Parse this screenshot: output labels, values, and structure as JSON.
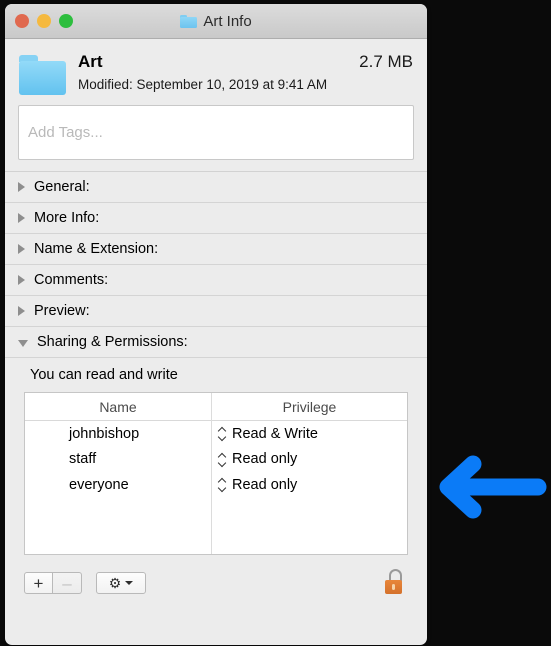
{
  "window": {
    "title": "Art Info",
    "title_icon": "folder-icon",
    "traffic_lights": [
      {
        "name": "close",
        "color": "#e0694f"
      },
      {
        "name": "minimize",
        "color": "#f5b93f"
      },
      {
        "name": "zoom",
        "color": "#2dbe3e"
      }
    ]
  },
  "header": {
    "icon": "folder-icon",
    "name": "Art",
    "size": "2.7 MB",
    "modified": "Modified: September 10, 2019 at 9:41 AM"
  },
  "tags": {
    "placeholder": "Add Tags...",
    "value": ""
  },
  "sections": [
    {
      "label": "General:",
      "expanded": false
    },
    {
      "label": "More Info:",
      "expanded": false
    },
    {
      "label": "Name & Extension:",
      "expanded": false
    },
    {
      "label": "Comments:",
      "expanded": false
    },
    {
      "label": "Preview:",
      "expanded": false
    },
    {
      "label": "Sharing & Permissions:",
      "expanded": true
    }
  ],
  "sharing": {
    "note": "You can read and write",
    "columns": [
      "Name",
      "Privilege"
    ],
    "rows": [
      {
        "icon": "single-person-icon",
        "name": "johnbishop",
        "privilege": "Read & Write"
      },
      {
        "icon": "two-people-icon",
        "name": "staff",
        "privilege": "Read only"
      },
      {
        "icon": "three-people-icon",
        "name": "everyone",
        "privilege": "Read only"
      }
    ]
  },
  "toolbar": {
    "add_label": "+",
    "remove_label": "–",
    "gear_label": "⚙",
    "lock_state": "unlocked"
  },
  "annotation": {
    "type": "arrow",
    "direction": "left",
    "color": "#0b7bf7"
  }
}
